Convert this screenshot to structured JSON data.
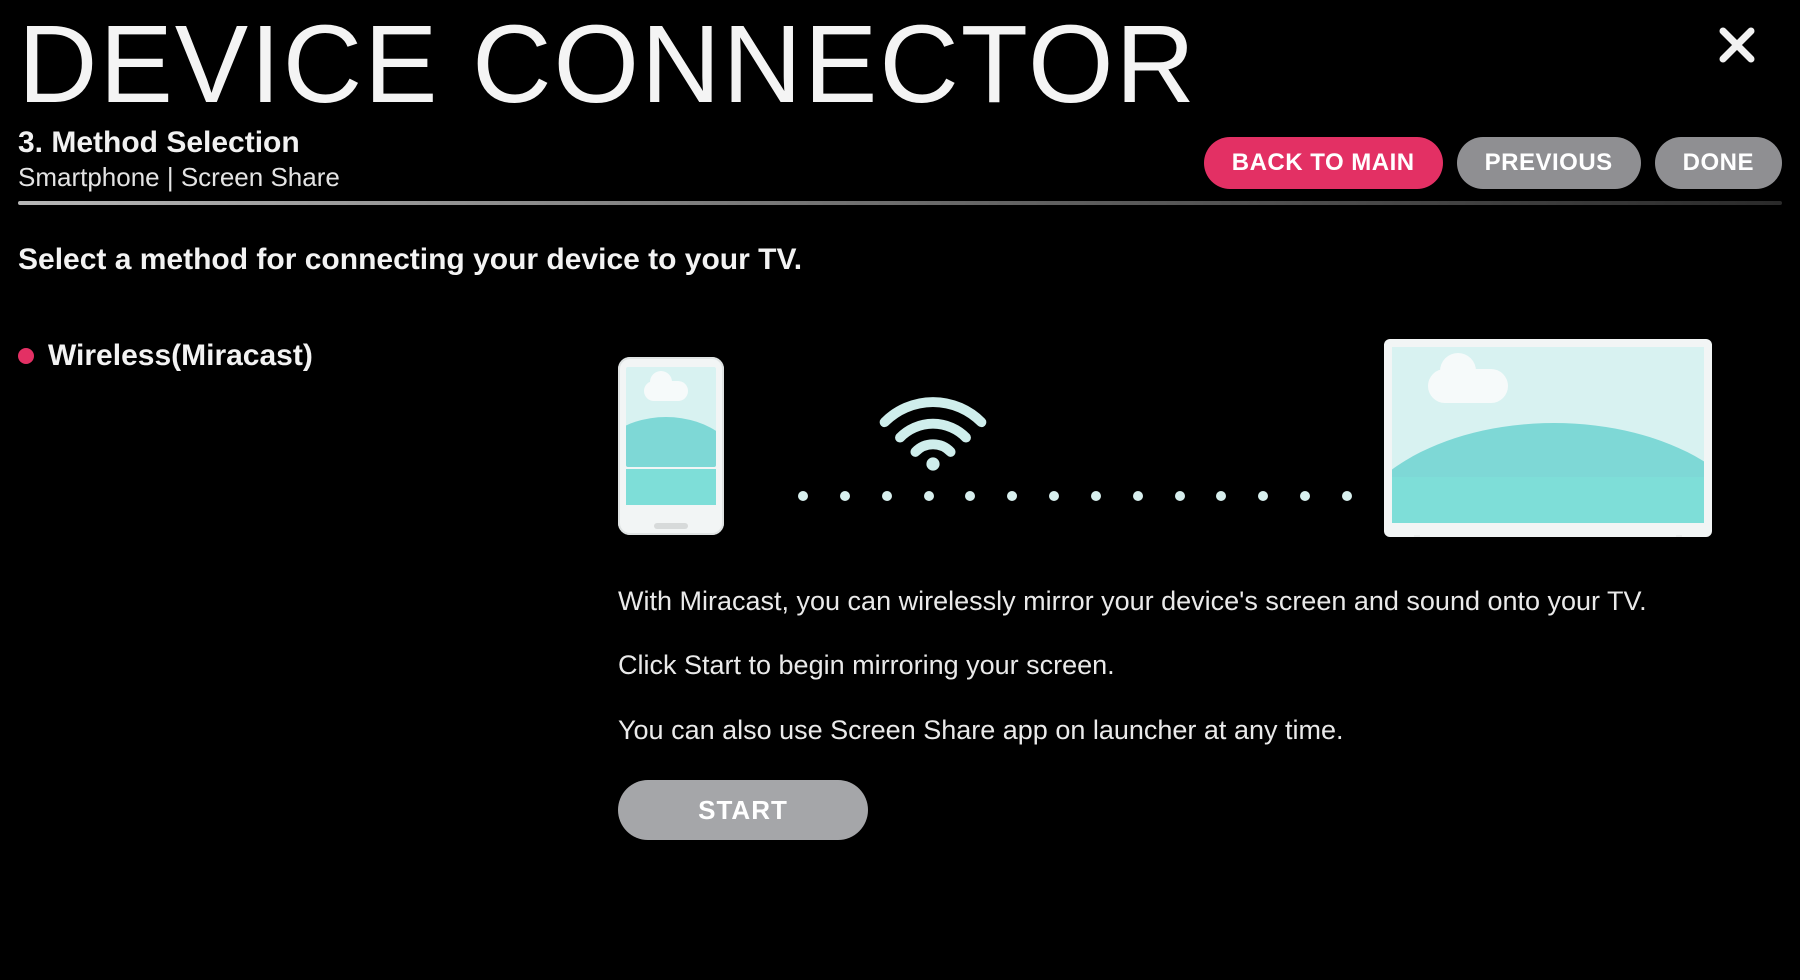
{
  "app_title": "DEVICE CONNECTOR",
  "step_title": "3. Method Selection",
  "breadcrumb": "Smartphone | Screen Share",
  "nav": {
    "back_to_main": "BACK TO MAIN",
    "previous": "PREVIOUS",
    "done": "DONE"
  },
  "prompt": "Select a method for connecting your device to your TV.",
  "options": [
    {
      "label": "Wireless(Miracast)",
      "selected": true
    }
  ],
  "detail": {
    "paragraphs": [
      "With Miracast, you can wirelessly mirror your device's screen and sound onto your TV.",
      "Click Start to begin mirroring your screen.",
      "You can also use Screen Share app on launcher at any time."
    ],
    "start_label": "START"
  }
}
